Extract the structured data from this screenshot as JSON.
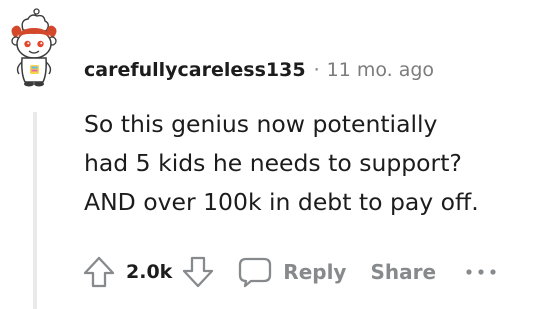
{
  "comment": {
    "username": "carefullycareless135",
    "separator": "·",
    "timestamp": "11 mo. ago",
    "body_lines": [
      "So this genius now potentially",
      "had 5 kids he needs to support?",
      "AND over 100k in debt to pay off."
    ],
    "vote_count": "2.0k",
    "reply_label": "Reply",
    "share_label": "Share"
  },
  "icons": {
    "avatar": "avatar-snoo",
    "upvote": "upvote-arrow-icon",
    "downvote": "downvote-arrow-icon",
    "reply": "speech-bubble-icon",
    "more": "ellipsis-icon"
  },
  "colors": {
    "text": "#1c1c1c",
    "muted": "#7c7c7c",
    "action": "#878a8c",
    "thread_line": "#e9e9e9"
  }
}
